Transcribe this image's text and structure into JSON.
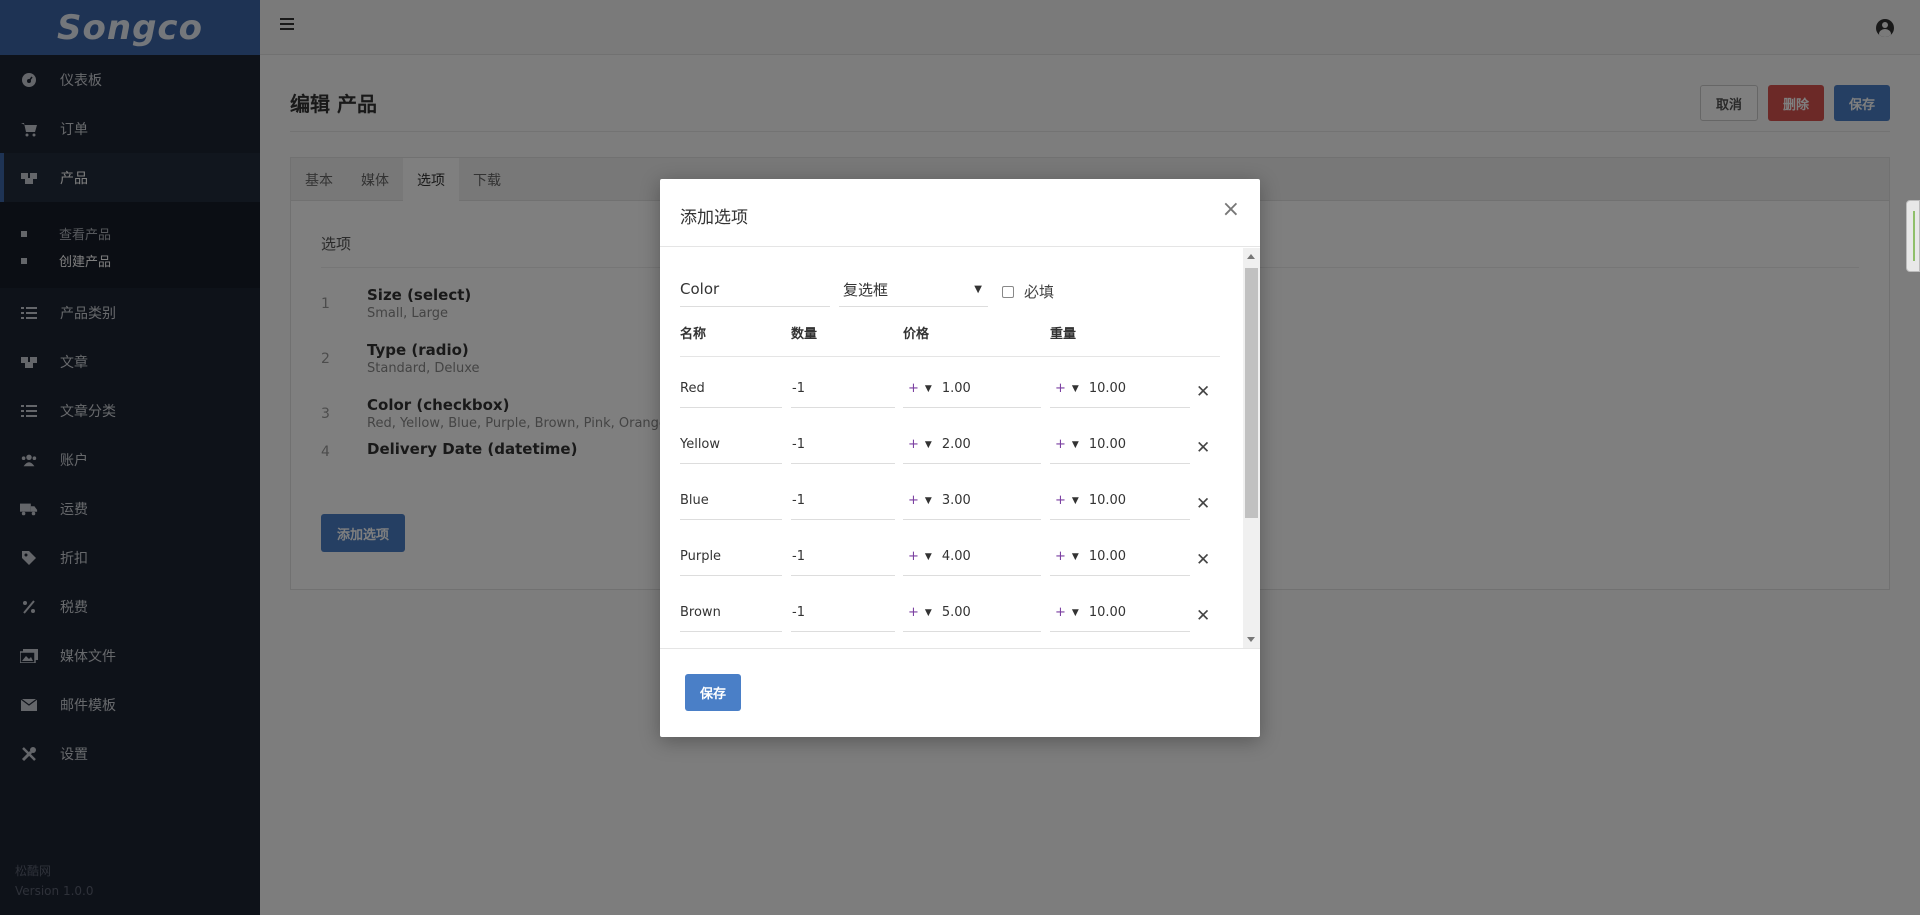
{
  "app": {
    "logo": "Songco",
    "footer_company": "松酷网",
    "footer_version": "Version 1.0.0"
  },
  "sidebar": {
    "items": [
      {
        "label": "仪表板",
        "icon": "dashboard-icon"
      },
      {
        "label": "订单",
        "icon": "cart-icon"
      },
      {
        "label": "产品",
        "icon": "cubes-icon",
        "active": true
      },
      {
        "label": "产品类别",
        "icon": "list-icon"
      },
      {
        "label": "文章",
        "icon": "cubes-icon"
      },
      {
        "label": "文章分类",
        "icon": "list-icon"
      },
      {
        "label": "账户",
        "icon": "users-icon"
      },
      {
        "label": "运费",
        "icon": "truck-icon"
      },
      {
        "label": "折扣",
        "icon": "tag-icon"
      },
      {
        "label": "税费",
        "icon": "percent-icon"
      },
      {
        "label": "媒体文件",
        "icon": "images-icon"
      },
      {
        "label": "邮件模板",
        "icon": "envelope-icon"
      },
      {
        "label": "设置",
        "icon": "tools-icon"
      }
    ],
    "sub_items": [
      {
        "label": "查看产品"
      },
      {
        "label": "创建产品",
        "active": true
      }
    ]
  },
  "page": {
    "title": "编辑 产品",
    "buttons": {
      "cancel": "取消",
      "delete": "删除",
      "save": "保存"
    },
    "tabs": [
      "基本",
      "媒体",
      "选项",
      "下载"
    ],
    "active_tab": "选项",
    "section_title": "选项",
    "options": [
      {
        "num": "1",
        "name": "Size (select)",
        "values": "Small, Large"
      },
      {
        "num": "2",
        "name": "Type (radio)",
        "values": "Standard, Deluxe"
      },
      {
        "num": "3",
        "name": "Color (checkbox)",
        "values": "Red, Yellow, Blue, Purple, Brown, Pink, Orange"
      },
      {
        "num": "4",
        "name": "Delivery Date (datetime)",
        "values": ""
      }
    ],
    "add_option_button": "添加选项"
  },
  "modal": {
    "title": "添加选项",
    "close": "×",
    "option_name": "Color",
    "option_type": "复选框",
    "required_label": "必填",
    "columns": {
      "name": "名称",
      "qty": "数量",
      "price": "价格",
      "weight": "重量"
    },
    "rows": [
      {
        "name": "Red",
        "qty": "-1",
        "price_sign": "+",
        "price": "1.00",
        "weight_sign": "+",
        "weight": "10.00"
      },
      {
        "name": "Yellow",
        "qty": "-1",
        "price_sign": "+",
        "price": "2.00",
        "weight_sign": "+",
        "weight": "10.00"
      },
      {
        "name": "Blue",
        "qty": "-1",
        "price_sign": "+",
        "price": "3.00",
        "weight_sign": "+",
        "weight": "10.00"
      },
      {
        "name": "Purple",
        "qty": "-1",
        "price_sign": "+",
        "price": "4.00",
        "weight_sign": "+",
        "weight": "10.00"
      },
      {
        "name": "Brown",
        "qty": "-1",
        "price_sign": "+",
        "price": "5.00",
        "weight_sign": "+",
        "weight": "10.00"
      }
    ],
    "save_button": "保存"
  },
  "colors": {
    "brand": "#3c66a8",
    "primary": "#4a7fc7",
    "danger": "#d9534f",
    "sidebar_bg": "#1d2433"
  }
}
